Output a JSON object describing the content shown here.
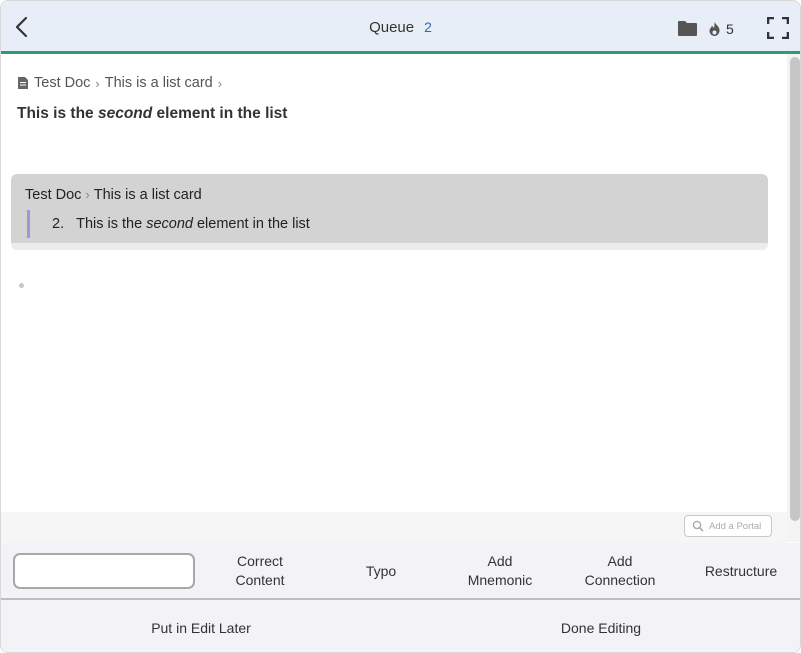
{
  "header": {
    "title": "Queue",
    "queue_count": "2",
    "fire_count": "5",
    "accent_color": "#2e9c78"
  },
  "card": {
    "breadcrumb": [
      "Test Doc",
      "This is a list card"
    ],
    "title": {
      "before": "This is the ",
      "emphasis": "second",
      "after": " element in the list"
    }
  },
  "context": {
    "breadcrumb": [
      "Test Doc",
      "This is a list card"
    ],
    "number": "2.",
    "text": {
      "before": "This is the ",
      "emphasis": "second",
      "after": " element in the list"
    }
  },
  "portal": {
    "label": "Add a Portal"
  },
  "actions": {
    "input_value": "",
    "buttons": [
      {
        "line1": "Correct",
        "line2": "Content"
      },
      {
        "line1": "Typo",
        "line2": ""
      },
      {
        "line1": "Add",
        "line2": "Mnemonic"
      },
      {
        "line1": "Add",
        "line2": "Connection"
      },
      {
        "line1": "Restructure",
        "line2": ""
      }
    ]
  },
  "bottom": {
    "edit_later": "Put in Edit Later",
    "done": "Done Editing"
  }
}
